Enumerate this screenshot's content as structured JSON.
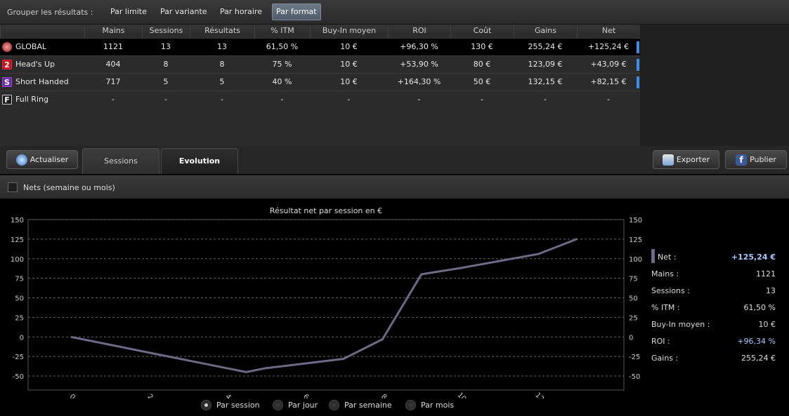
{
  "group_bar": {
    "label": "Grouper les résultats :",
    "options": [
      "Par limite",
      "Par variante",
      "Par horaire",
      "Par format"
    ],
    "active": "Par format"
  },
  "table": {
    "headers": [
      "Mains",
      "Sessions",
      "Résultats",
      "% ITM",
      "Buy-In moyen",
      "ROI",
      "Coût",
      "Gains",
      "Net"
    ],
    "rows": [
      {
        "icon": "global-icon",
        "name": "GLOBAL",
        "cells": [
          "1121",
          "13",
          "13",
          "61,50 %",
          "10 €",
          "+96,30 %",
          "130 €",
          "255,24 €",
          "+125,24 €"
        ]
      },
      {
        "icon": "2",
        "name": "Head's Up",
        "cells": [
          "404",
          "8",
          "8",
          "75 %",
          "10 €",
          "+53,90 %",
          "80 €",
          "123,09 €",
          "+43,09 €"
        ]
      },
      {
        "icon": "S",
        "name": "Short Handed",
        "cells": [
          "717",
          "5",
          "5",
          "40 %",
          "10 €",
          "+164,30 %",
          "50 €",
          "132,15 €",
          "+82,15 €"
        ]
      },
      {
        "icon": "F",
        "name": "Full Ring",
        "cells": [
          "-",
          "-",
          "-",
          "-",
          "-",
          "-",
          "-",
          "-",
          "-"
        ]
      }
    ],
    "net_bar_color": "#3a8ee6"
  },
  "tabs": {
    "refresh_label": "Actualiser",
    "sessions_label": "Sessions",
    "evolution_label": "Evolution",
    "export_label": "Exporter",
    "publish_label": "Publier"
  },
  "options": {
    "nets_label": "Nets (semaine ou mois)"
  },
  "chart_data": {
    "type": "line",
    "title": "Résultat net par session en €",
    "xlabel": "",
    "ylabel": "",
    "ylim": [
      -50,
      150
    ],
    "y_ticks": [
      150,
      125,
      100,
      75,
      50,
      25,
      0,
      -25,
      -50
    ],
    "x_ticks": [
      "0",
      "2",
      "4",
      "6",
      "8",
      "10",
      "12"
    ],
    "x_range": [
      -1.1,
      14.2
    ],
    "grid": true,
    "series": [
      {
        "color": "#6e6a86",
        "x": [
          0,
          1,
          2,
          3,
          4,
          4.5,
          5,
          6,
          7,
          8,
          9,
          10,
          11,
          12,
          13
        ],
        "values": [
          0,
          -10,
          -20,
          -30,
          -40,
          -45,
          -40,
          -34,
          -28,
          -3,
          80,
          88,
          97,
          106,
          125.24
        ]
      }
    ]
  },
  "stats": [
    {
      "label": "Net :",
      "value": "+125,24 €",
      "highlight": true
    },
    {
      "label": "Mains :",
      "value": "1121"
    },
    {
      "label": "Sessions :",
      "value": "13"
    },
    {
      "label": "% ITM :",
      "value": "61,50 %"
    },
    {
      "label": "Buy-In moyen :",
      "value": "10 €"
    },
    {
      "label": "ROI :",
      "value": "+96,34 %",
      "blue": true
    },
    {
      "label": "Gains :",
      "value": "255,24 €"
    }
  ],
  "radios": {
    "options": [
      "Par session",
      "Par jour",
      "Par semaine",
      "Par mois"
    ],
    "selected": "Par session"
  }
}
